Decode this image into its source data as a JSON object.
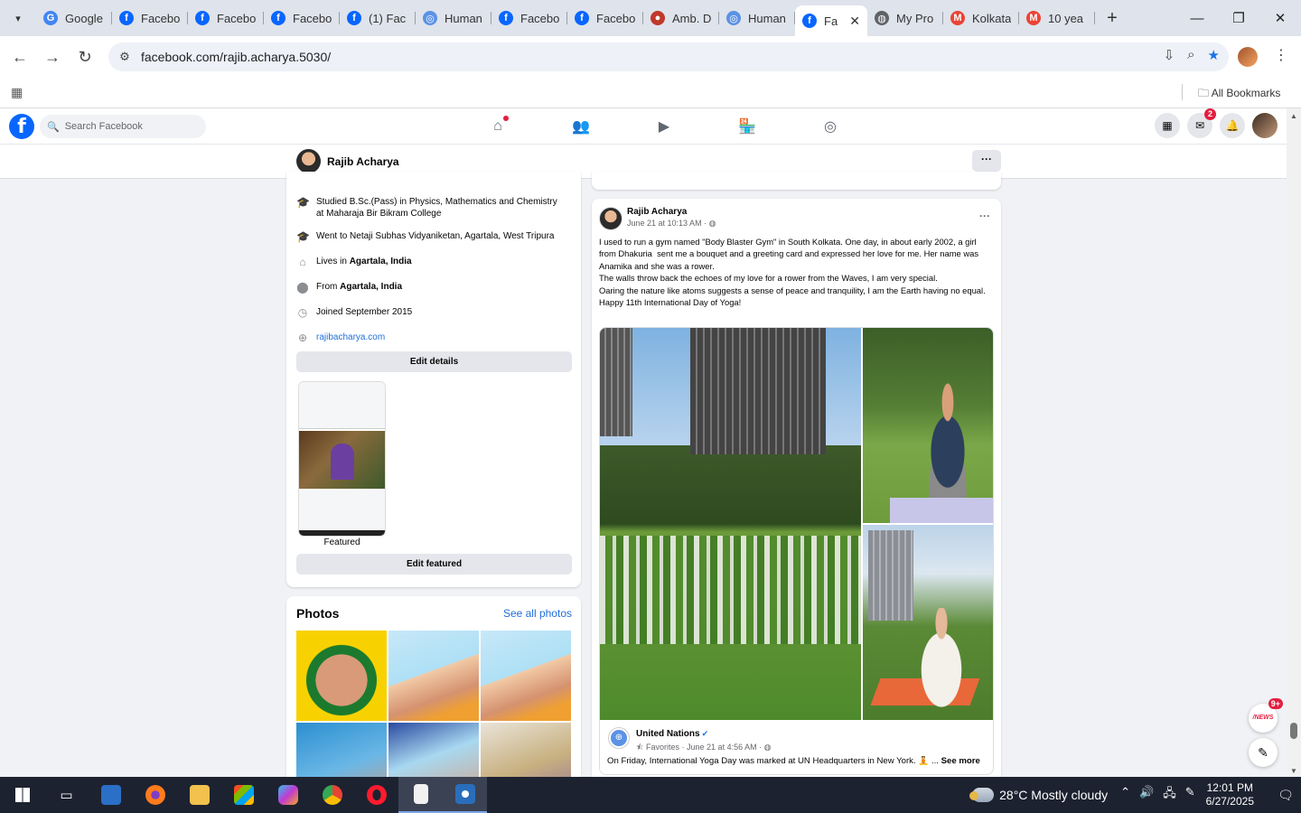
{
  "browser": {
    "tabs": [
      {
        "title": "Google",
        "icon": "google-icon",
        "color": "#4285f4"
      },
      {
        "title": "Facebo",
        "icon": "facebook-icon",
        "color": "#0866ff"
      },
      {
        "title": "Facebo",
        "icon": "facebook-icon",
        "color": "#0866ff"
      },
      {
        "title": "Facebo",
        "icon": "facebook-icon",
        "color": "#0866ff"
      },
      {
        "title": "(1) Fac",
        "icon": "facebook-icon",
        "color": "#0866ff"
      },
      {
        "title": "Human",
        "icon": "un-icon",
        "color": "#5b92e5"
      },
      {
        "title": "Facebo",
        "icon": "facebook-icon",
        "color": "#0866ff"
      },
      {
        "title": "Facebo",
        "icon": "facebook-icon",
        "color": "#0866ff"
      },
      {
        "title": "Amb. D",
        "icon": "amb-icon",
        "color": "#c0392b"
      },
      {
        "title": "Human",
        "icon": "un-icon",
        "color": "#5b92e5"
      },
      {
        "title": "Fa",
        "icon": "facebook-icon",
        "color": "#0866ff",
        "active": true
      },
      {
        "title": "My Pro",
        "icon": "globe-icon",
        "color": "#5f6368"
      },
      {
        "title": "Kolkata",
        "icon": "gmail-icon",
        "color": "#ea4335"
      },
      {
        "title": "10 yea",
        "icon": "gmail-icon",
        "color": "#ea4335"
      }
    ],
    "url": "facebook.com/rajib.acharya.5030/",
    "bookmarks_label": "All Bookmarks"
  },
  "facebook": {
    "search_placeholder": "Search Facebook",
    "messenger_badge": "2",
    "profile_name": "Rajib Acharya",
    "more_label": "···"
  },
  "intro": {
    "items": [
      {
        "icon": "graduation-cap-icon",
        "text": "Studied B.Sc.(Pass) in Physics, Mathematics and Chemistry at Maharaja Bir Bikram College"
      },
      {
        "icon": "graduation-cap-icon",
        "text": "Went to Netaji Subhas Vidyaniketan, Agartala, West Tripura"
      },
      {
        "icon": "home-icon",
        "prefix": "Lives in ",
        "bold": "Agartala, India"
      },
      {
        "icon": "location-pin-icon",
        "prefix": "From ",
        "bold": "Agartala, India"
      },
      {
        "icon": "clock-icon",
        "text": "Joined September 2015"
      },
      {
        "icon": "globe-icon",
        "link": "rajibacharya.com"
      }
    ],
    "edit_details": "Edit details",
    "featured_label": "Featured",
    "edit_featured": "Edit featured"
  },
  "photos": {
    "title": "Photos",
    "see_all": "See all photos"
  },
  "post": {
    "author": "Rajib Acharya",
    "meta": "June 21 at 10:13 AM · ",
    "more": "···",
    "lines": [
      "I used to run a gym named \"Body Blaster Gym\" in South Kolkata. One day, in about early 2002, a girl from Dhakuria  sent me a bouquet and a greeting card and expressed her love for me. Her name was Anamika and she was a rower.",
      "The walls throw back the echoes of my love for a rower from the Waves, I am very special.",
      "Oaring the nature like atoms suggests a sense of peace and tranquility, I am the Earth having no equal.",
      "Happy 11th International Day of Yoga!"
    ],
    "shared": {
      "page": "United Nations",
      "meta": "⯪ Favorites · June 21 at 4:56 AM · ",
      "text": "On Friday, International Yoga Day was marked at UN Headquarters in New York. 🧘 ...",
      "see_more": "See more"
    }
  },
  "floating": {
    "news_badge": "9+",
    "news_label": "/NEWS"
  },
  "taskbar": {
    "weather": "28°C  Mostly cloudy",
    "time": "12:01 PM",
    "date": "6/27/2025"
  }
}
